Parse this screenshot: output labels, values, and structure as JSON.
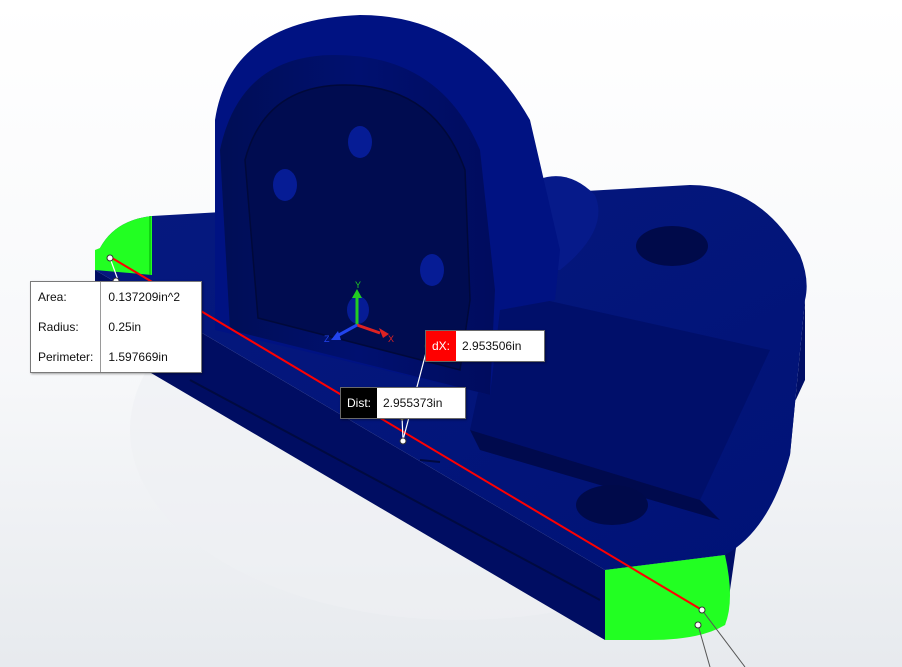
{
  "measurement": {
    "properties": [
      {
        "label": "Area:",
        "value": "0.137209in^2"
      },
      {
        "label": "Radius:",
        "value": "0.25in"
      },
      {
        "label": "Perimeter:",
        "value": "1.597669in"
      }
    ],
    "dx": {
      "label": "dX:",
      "value": "2.953506in"
    },
    "dist": {
      "label": "Dist:",
      "value": "2.955373in"
    }
  },
  "triad": {
    "x": "X",
    "y": "Y",
    "z": "Z"
  },
  "colors": {
    "part_blue": "#00127a",
    "part_dark": "#000a4f",
    "selected_face": "#22ff22",
    "measure_line": "#ff0000",
    "dx_tag": "#ff0000",
    "dist_tag": "#000000"
  }
}
